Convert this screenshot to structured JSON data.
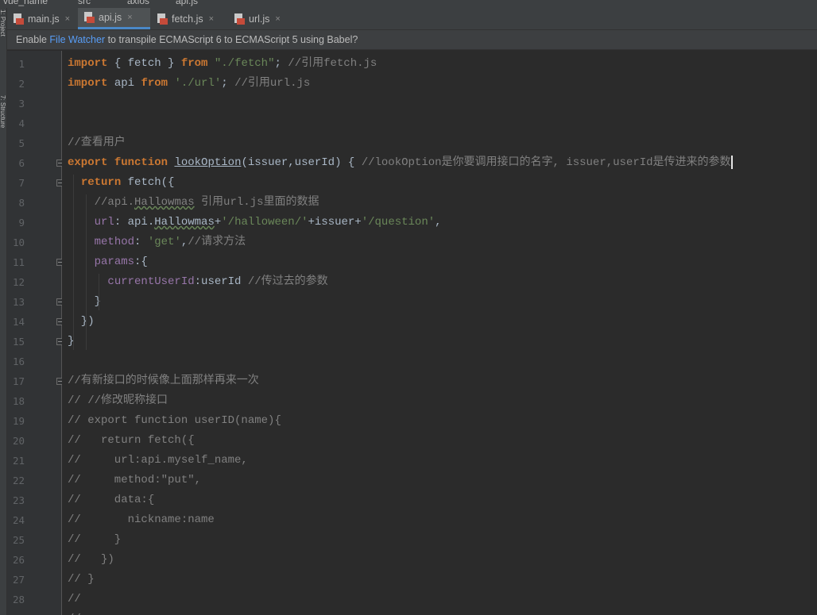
{
  "breadcrumb": {
    "project": "vue_name",
    "src": "src",
    "folder": "axios",
    "file": "api.js"
  },
  "sidebar": {
    "panel_a": "1: Project",
    "panel_b": "7: Structure"
  },
  "tabs": [
    {
      "label": "main.js",
      "active": false
    },
    {
      "label": "api.js",
      "active": true
    },
    {
      "label": "fetch.js",
      "active": false
    },
    {
      "label": "url.js",
      "active": false
    }
  ],
  "close_glyph": "×",
  "banner": {
    "prefix": "Enable ",
    "link": "File Watcher",
    "suffix": " to transpile ECMAScript 6 to ECMAScript 5 using Babel?"
  },
  "editor": {
    "line_numbers": [
      "1",
      "2",
      "3",
      "4",
      "5",
      "6",
      "7",
      "8",
      "9",
      "10",
      "11",
      "12",
      "13",
      "14",
      "15",
      "16",
      "17",
      "18",
      "19",
      "20",
      "21",
      "22",
      "23",
      "24",
      "25",
      "26",
      "27",
      "28"
    ],
    "lines": [
      [
        [
          "kw",
          "import"
        ],
        [
          "fn",
          " { fetch } "
        ],
        [
          "kw",
          "from"
        ],
        [
          "fn",
          " "
        ],
        [
          "str",
          "\"./fetch\""
        ],
        [
          "fn",
          "; "
        ],
        [
          "cm",
          "//引用fetch.js"
        ]
      ],
      [
        [
          "kw",
          "import"
        ],
        [
          "fn",
          " api "
        ],
        [
          "kw",
          "from"
        ],
        [
          "fn",
          " "
        ],
        [
          "str",
          "'./url'"
        ],
        [
          "fn",
          "; "
        ],
        [
          "cm",
          "//引用url.js"
        ]
      ],
      [],
      [],
      [
        [
          "cm",
          "//查看用户"
        ]
      ],
      [
        [
          "kw",
          "export"
        ],
        [
          "fn",
          " "
        ],
        [
          "kw",
          "function"
        ],
        [
          "fn",
          " "
        ],
        [
          "undl",
          "lookOption"
        ],
        [
          "fn",
          "(issuer,userId) { "
        ],
        [
          "cm",
          "//lookOption是你要调用接口的名字, issuer,userId是传进来的参数"
        ]
      ],
      [
        [
          "fn",
          "  "
        ],
        [
          "kw",
          "return"
        ],
        [
          "fn",
          " fetch({"
        ]
      ],
      [
        [
          "fn",
          "    "
        ],
        [
          "cm",
          "//api."
        ],
        [
          "cmund",
          "Hallowmas"
        ],
        [
          "cm",
          " 引用url.js里面的数据"
        ]
      ],
      [
        [
          "fn",
          "    "
        ],
        [
          "prop",
          "url"
        ],
        [
          "fn",
          ": api."
        ],
        [
          "und",
          "Hallowmas"
        ],
        [
          "fn",
          "+"
        ],
        [
          "str",
          "'/halloween/'"
        ],
        [
          "fn",
          "+issuer+"
        ],
        [
          "str",
          "'/question'"
        ],
        [
          "fn",
          ","
        ]
      ],
      [
        [
          "fn",
          "    "
        ],
        [
          "prop",
          "method"
        ],
        [
          "fn",
          ": "
        ],
        [
          "str",
          "'get'"
        ],
        [
          "fn",
          ","
        ],
        [
          "cm",
          "//请求方法"
        ]
      ],
      [
        [
          "fn",
          "    "
        ],
        [
          "prop",
          "params"
        ],
        [
          "fn",
          ":{"
        ]
      ],
      [
        [
          "fn",
          "      "
        ],
        [
          "prop",
          "currentUserId"
        ],
        [
          "fn",
          ":userId "
        ],
        [
          "cm",
          "//传过去的参数"
        ]
      ],
      [
        [
          "fn",
          "    }"
        ]
      ],
      [
        [
          "fn",
          "  })"
        ]
      ],
      [
        [
          "fn",
          "}"
        ]
      ],
      [],
      [
        [
          "cm",
          "//有新接口的时候像上面那样再来一次"
        ]
      ],
      [
        [
          "cm",
          "// //修改昵称接口"
        ]
      ],
      [
        [
          "cm",
          "// export function userID(name){"
        ]
      ],
      [
        [
          "cm",
          "//   return fetch({"
        ]
      ],
      [
        [
          "cm",
          "//     url:api.myself_name,"
        ]
      ],
      [
        [
          "cm",
          "//     method:\"put\","
        ]
      ],
      [
        [
          "cm",
          "//     data:{"
        ]
      ],
      [
        [
          "cm",
          "//       nickname:name"
        ]
      ],
      [
        [
          "cm",
          "//     }"
        ]
      ],
      [
        [
          "cm",
          "//   })"
        ]
      ],
      [
        [
          "cm",
          "// }"
        ]
      ],
      [
        [
          "cm",
          "//"
        ]
      ],
      [
        [
          "cm",
          "//"
        ]
      ]
    ]
  },
  "colors": {
    "keyword": "#cc7832",
    "string": "#6a8759",
    "comment": "#808080",
    "property": "#9876aa",
    "text": "#a9b7c6",
    "link": "#589df6",
    "tab_underline": "#4a88c7"
  }
}
